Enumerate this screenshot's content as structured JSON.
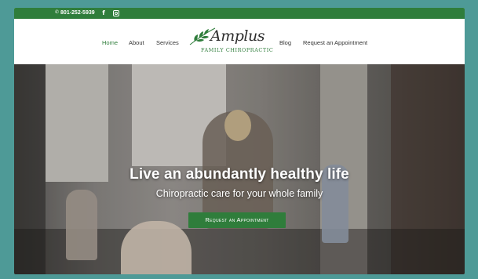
{
  "topbar": {
    "phone": "801-252-5939",
    "phone_icon": "phone-icon",
    "social": [
      {
        "icon": "facebook-icon",
        "glyph": "f"
      },
      {
        "icon": "instagram-icon"
      }
    ],
    "background": "#2f7d3b"
  },
  "nav": {
    "items": [
      {
        "label": "Home",
        "active": true
      },
      {
        "label": "About",
        "active": false
      },
      {
        "label": "Services",
        "active": false
      },
      {
        "label": "Blog",
        "active": false
      },
      {
        "label": "Request an Appointment",
        "active": false
      }
    ],
    "active_color": "#2f7d3b"
  },
  "logo": {
    "script": "Amplus",
    "subtitle": "FAMILY CHIROPRACTIC",
    "icon": "leaf-icon"
  },
  "hero": {
    "title": "Live an abundantly healthy life",
    "subtitle": "Chiropractic care for your whole family",
    "cta_label": "Request an Appointment",
    "cta_color": "#2f7d3b"
  },
  "frame_color": "#4e9a97"
}
